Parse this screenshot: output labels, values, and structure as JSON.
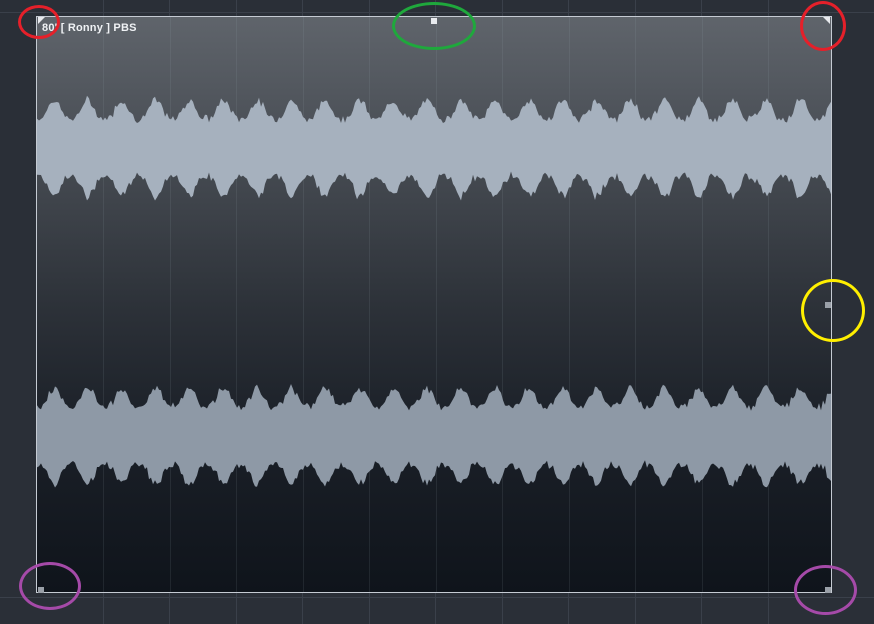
{
  "event": {
    "title": "80' [ Ronny ] PBS"
  },
  "highlights": {
    "top_left": "#e5202a",
    "top_right": "#e5202a",
    "top_center": "#1fa83c",
    "right_middle": "#ffef00",
    "bottom_left": "#a54aa8",
    "bottom_right": "#a54aa8"
  },
  "colors": {
    "waveform_upper": "#a6b1be",
    "waveform_lower": "#8e99a6",
    "event_border": "#c5cbd3"
  },
  "icons": {
    "fade_in": "fade-in-handle-icon",
    "fade_out": "fade-out-handle-icon",
    "volume": "volume-handle-icon",
    "sizing": "sizing-handle-icon"
  }
}
